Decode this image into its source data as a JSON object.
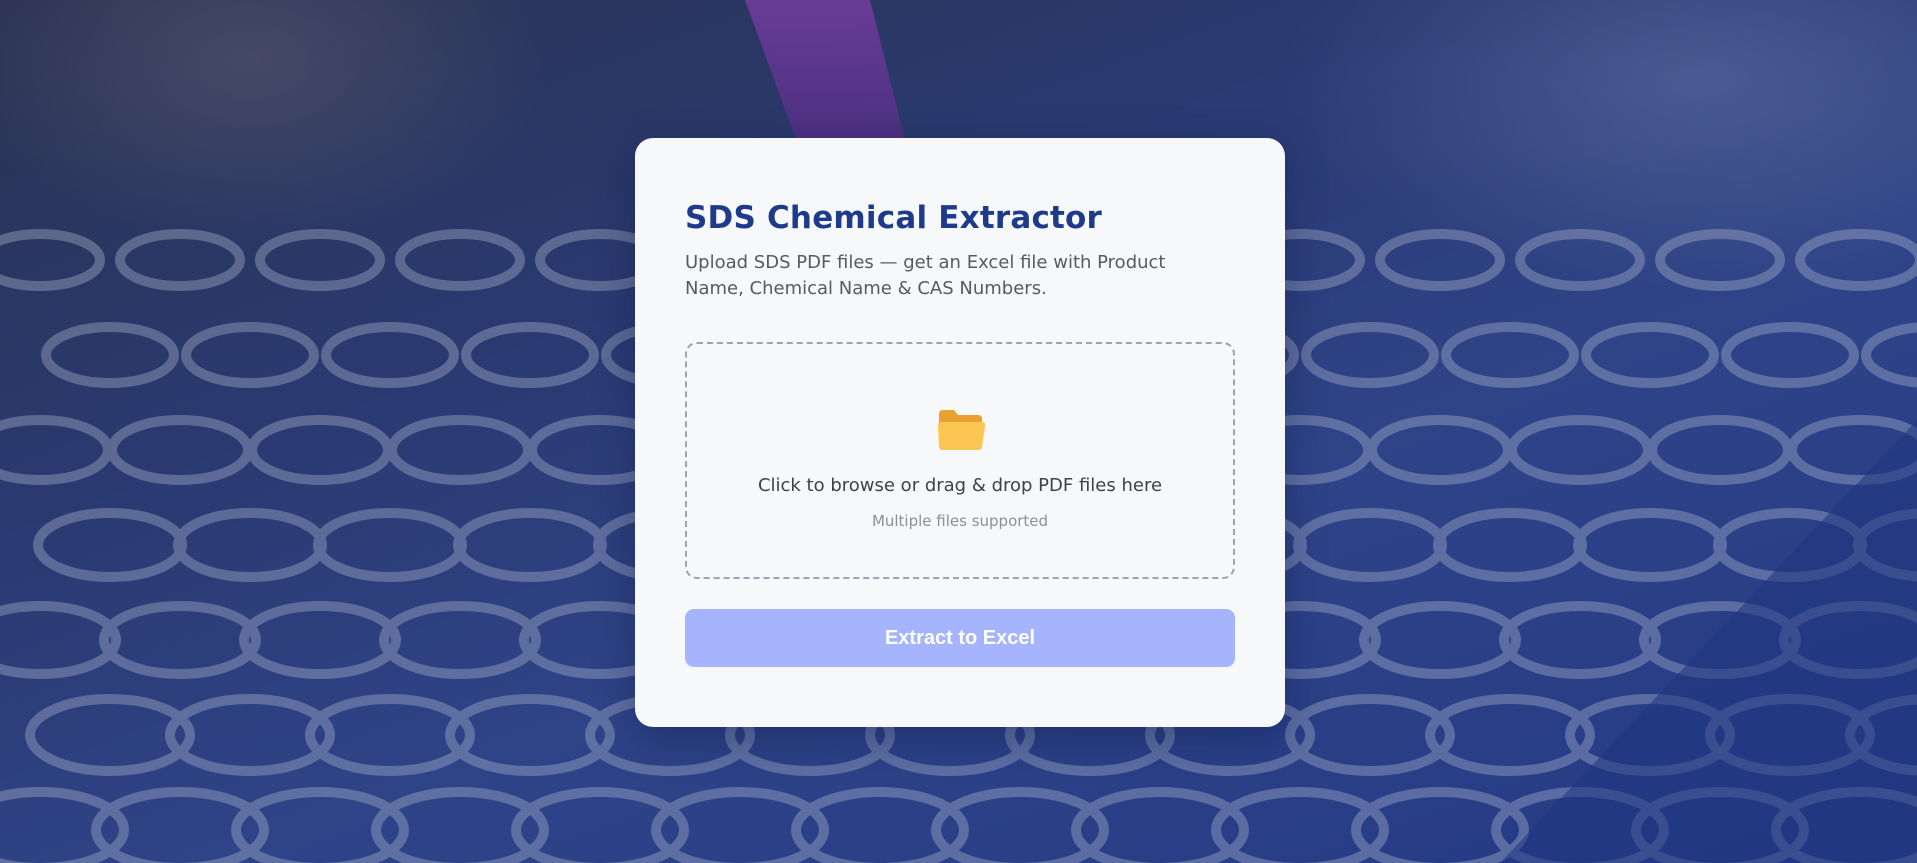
{
  "app": {
    "title": "SDS Chemical Extractor",
    "subtitle": "Upload SDS PDF files — get an Excel file with Product Name, Chemical Name & CAS Numbers."
  },
  "dropzone": {
    "icon": "folder-icon",
    "main_text": "Click to browse or drag & drop PDF files here",
    "sub_text": "Multiple files supported"
  },
  "actions": {
    "extract_label": "Extract to Excel"
  },
  "colors": {
    "title": "#1e3a8a",
    "button_disabled": "#a5b4fc",
    "card": "#f7f8fa",
    "folder": "#f5b942"
  }
}
